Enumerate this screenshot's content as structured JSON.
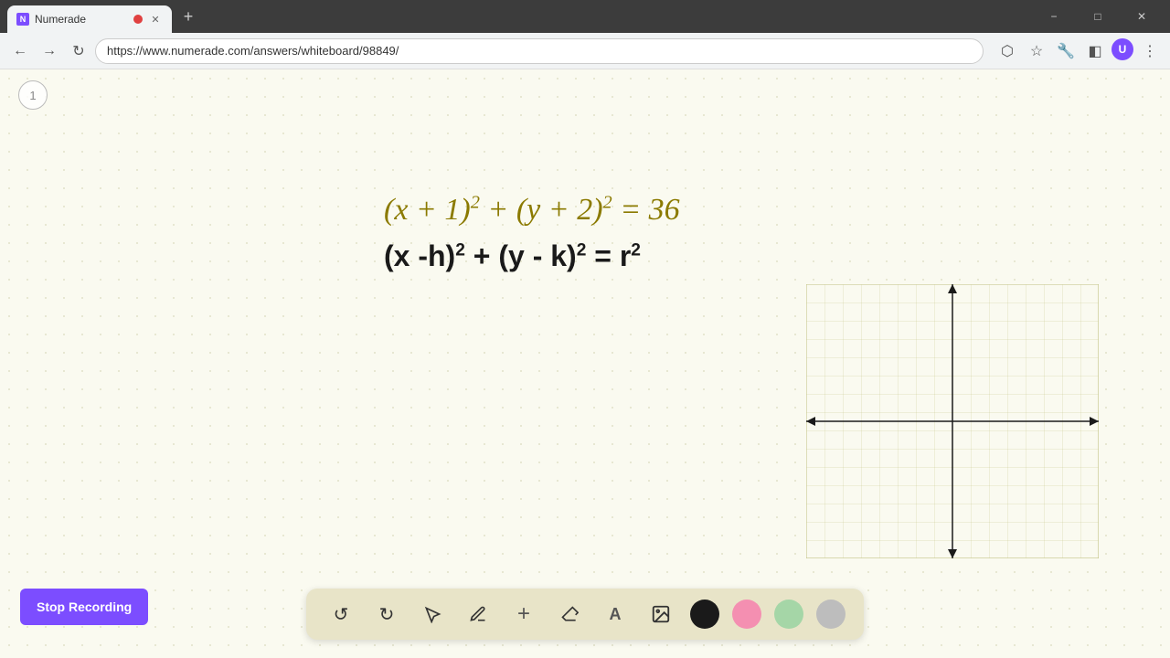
{
  "browser": {
    "tab_title": "Numerade",
    "tab_favicon": "N",
    "url": "https://www.numerade.com/answers/whiteboard/98849/",
    "new_tab_label": "+",
    "window_minimize": "−",
    "window_maximize": "□",
    "window_close": "✕"
  },
  "nav": {
    "back_label": "←",
    "forward_label": "→",
    "refresh_label": "↻"
  },
  "page": {
    "number": "1",
    "equation1": "(x + 1)² + (y + 2)² = 36",
    "equation2": "(x - h)² + (y - k)² = r²"
  },
  "toolbar": {
    "undo_label": "↺",
    "redo_label": "↻",
    "select_label": "▲",
    "pen_label": "✏",
    "add_label": "+",
    "eraser_label": "/",
    "text_label": "A",
    "image_label": "🖼",
    "color_black": "#1a1a1a",
    "color_pink": "#f48fb1",
    "color_green": "#a5d6a7",
    "color_gray": "#bdbdbd",
    "stop_recording_label": "Stop Recording"
  }
}
